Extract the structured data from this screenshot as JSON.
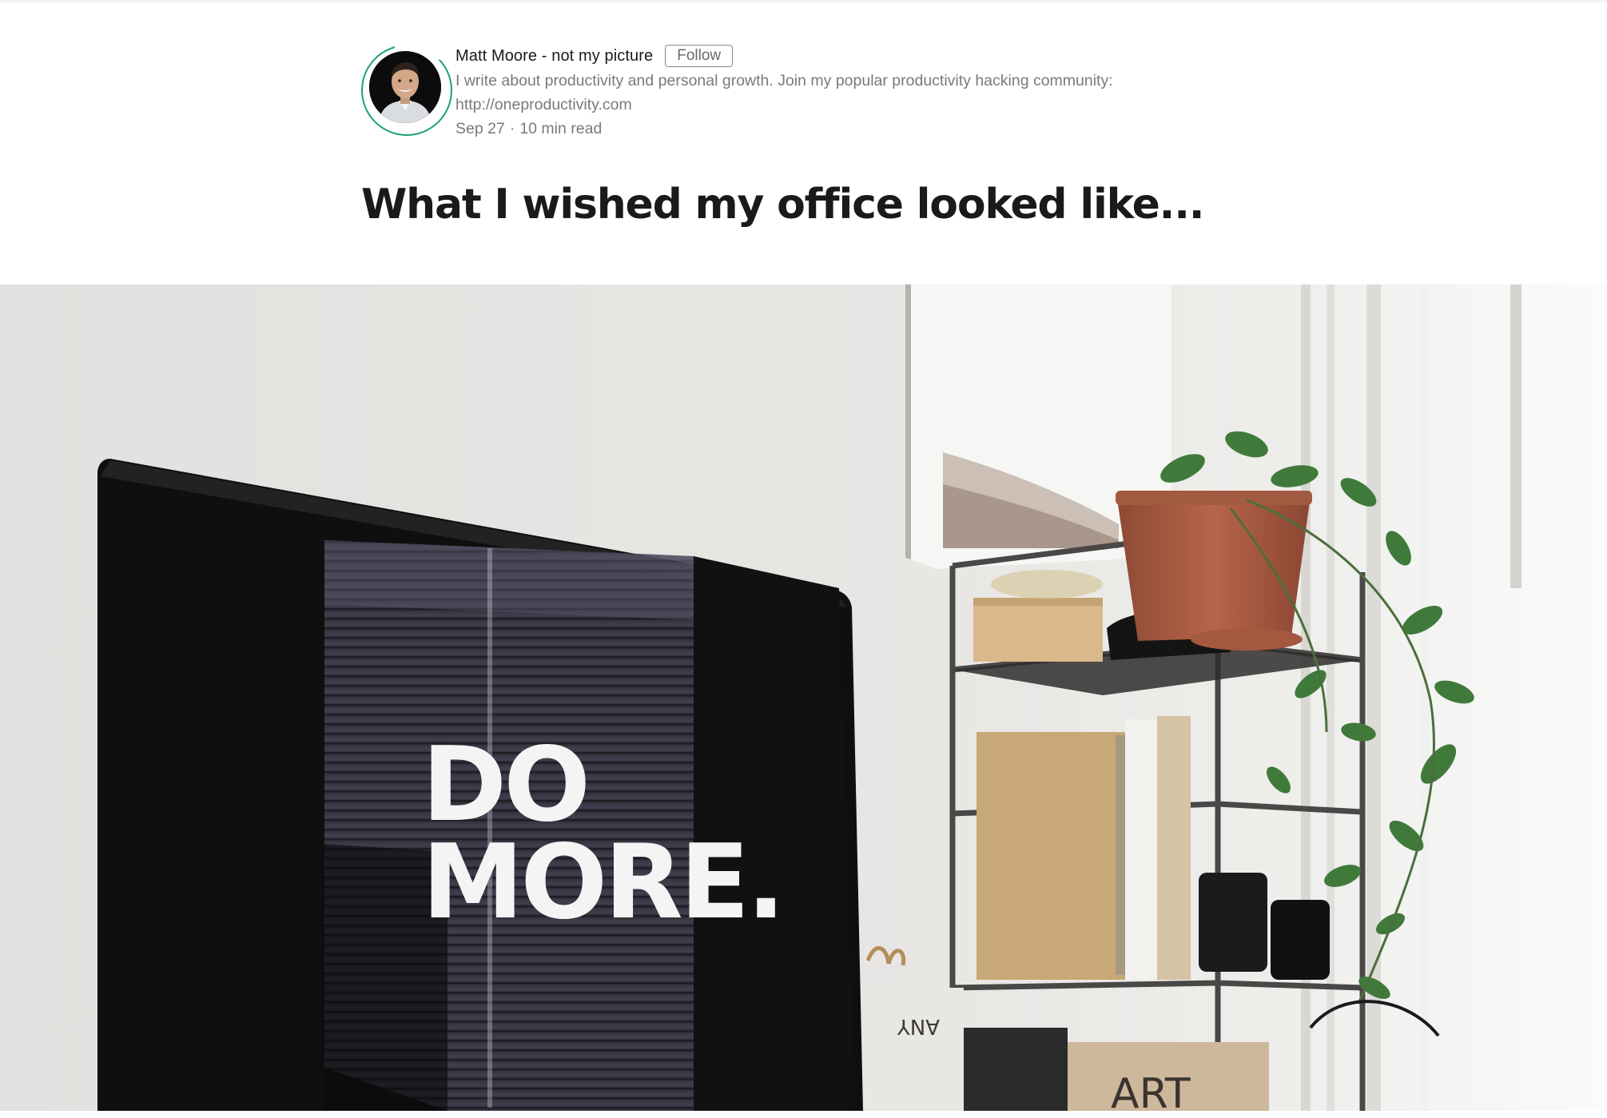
{
  "author": {
    "name": "Matt Moore - not my picture",
    "follow_label": "Follow",
    "bio_line1": "I write about productivity and personal growth. Join my popular productivity hacking community:",
    "bio_line2": "http://oneproductivity.com",
    "date": "Sep 27",
    "separator": "·",
    "read_time": "10 min read"
  },
  "article": {
    "title": "What I wished my office looked like..."
  },
  "hero_image": {
    "screen_text_line1": "DO",
    "screen_text_line2": "MORE.",
    "box_text": "ANY",
    "bag_text": "ART"
  },
  "colors": {
    "accent": "#1ca36b",
    "title": "#1a1a1a",
    "muted": "#7a7a7a"
  }
}
